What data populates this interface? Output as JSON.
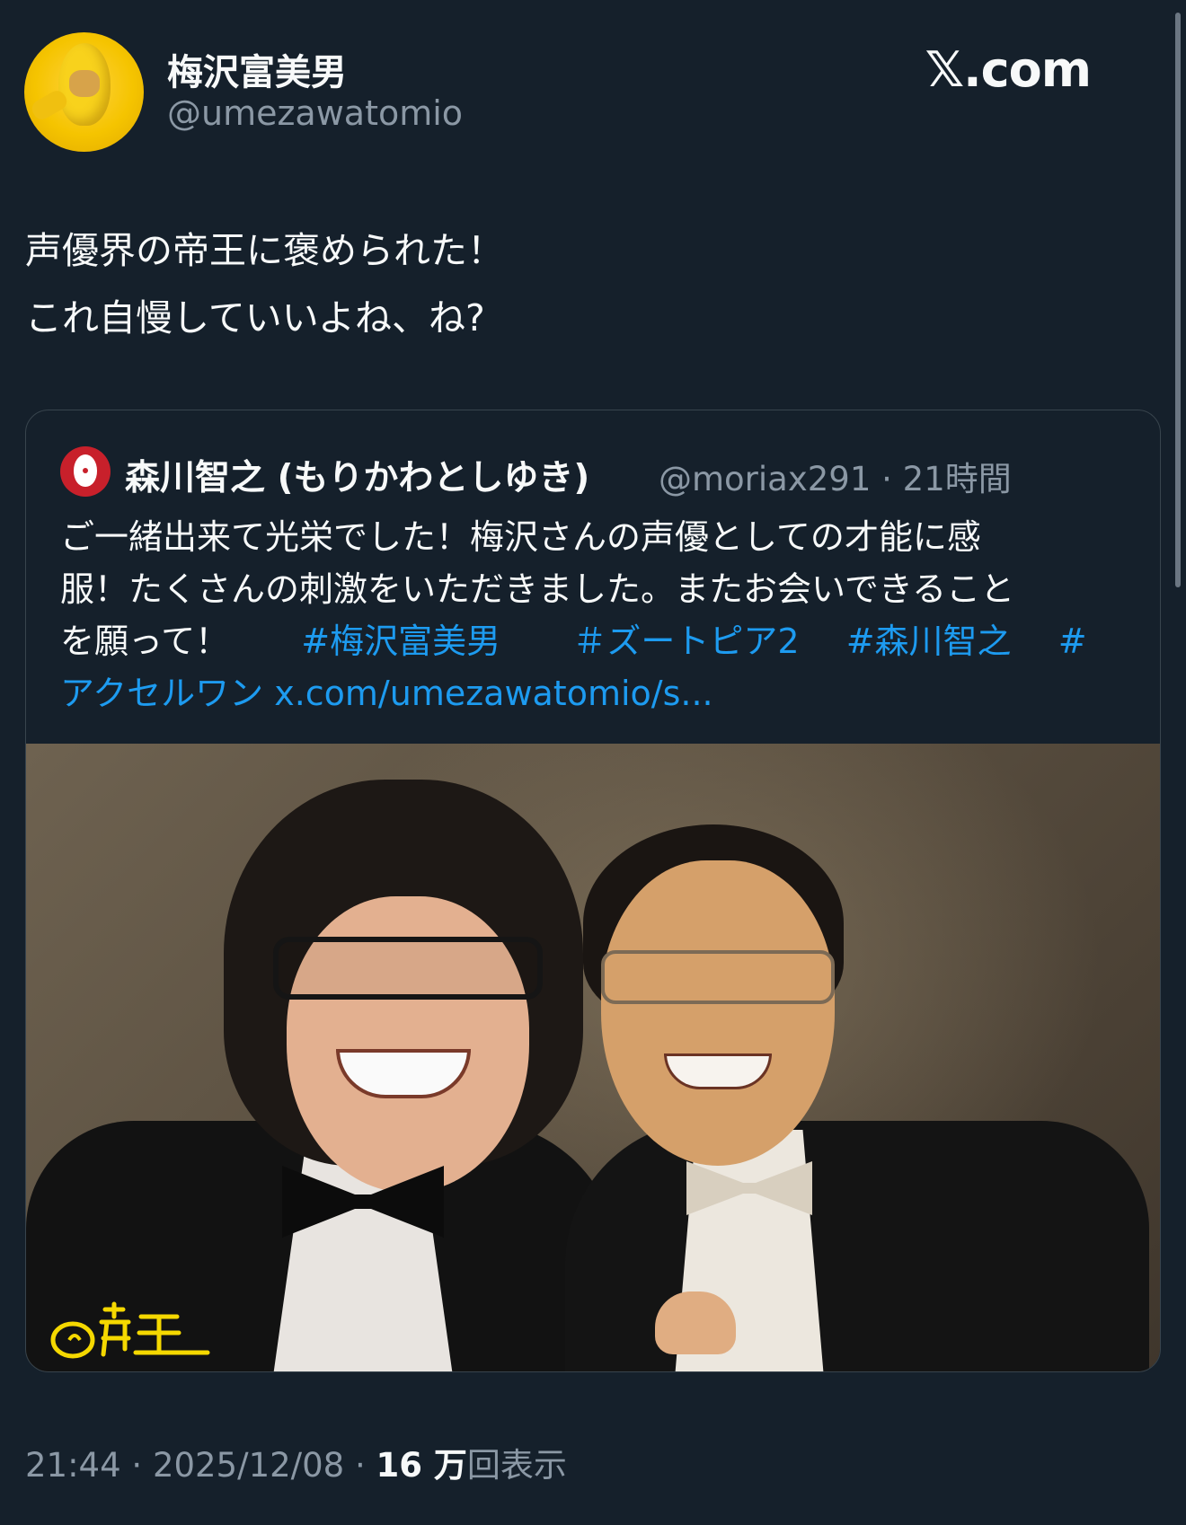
{
  "author": {
    "name": "梅沢富美男",
    "handle": "@umezawatomio"
  },
  "brand": {
    "label": "𝕏.com"
  },
  "tweet": {
    "lines": [
      "声優界の帝王に褒められた！",
      "これ自慢していいよね、ね?"
    ]
  },
  "quote": {
    "name": "森川智之 (もりかわとしゆき)",
    "handle": "@moriax291",
    "separator": "·",
    "time": "21時間",
    "body": {
      "line1": "ご一緒出来て光栄でした！梅沢さんの声優としての才能に感",
      "line2": "服！たくさんの刺激をいただきました。またお会いできること",
      "line3_text": "を願って！",
      "hashtags": [
        "#梅沢富美男",
        "＃ズートピア2",
        "#森川智之",
        "#"
      ],
      "line4_hashtag": "アクセルワン",
      "link": "x.com/umezawatomio/s..."
    },
    "photo_signature": "©帝王"
  },
  "footer": {
    "time": "21:44",
    "separator": "·",
    "date": "2025/12/08",
    "separator2": "·",
    "views_count": "16 万",
    "views_label": "回表示"
  },
  "colors": {
    "background": "#15202b",
    "text": "#f7f9f9",
    "muted": "#8b98a5",
    "link": "#1d9bf0",
    "border": "#38444d",
    "signature": "#f5d800"
  },
  "icons": {
    "avatar": "lemon-costume-avatar",
    "quote_avatar": "egg-avatar"
  }
}
